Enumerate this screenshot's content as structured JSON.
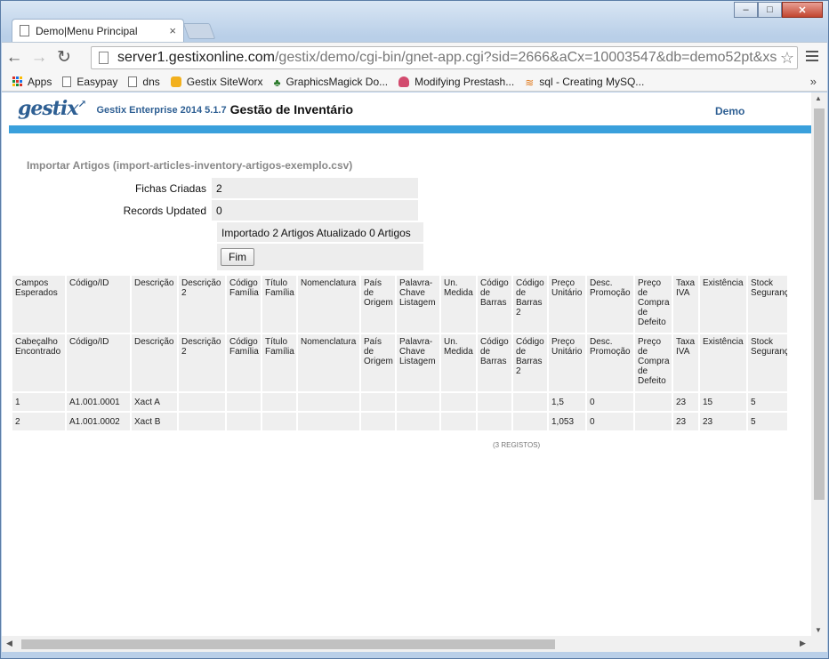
{
  "browser": {
    "tab_title": "Demo|Menu Principal",
    "tab_close": "×",
    "url_host": "server1.gestixonline.com",
    "url_path": "/gestix/demo/cgi-bin/gnet-app.cgi?sid=2666&aCx=10003547&db=demo52pt&xs",
    "bookmarks": [
      "Apps",
      "Easypay",
      "dns",
      "Gestix SiteWorx",
      "GraphicsMagick Do...",
      "Modifying Prestash...",
      "sql - Creating MySQ..."
    ],
    "bookmarks_more": "»"
  },
  "app": {
    "logo": "gestix",
    "version": "Gestix Enterprise 2014 5.1.7",
    "module": "Gestão de Inventário",
    "user": "Demo"
  },
  "import": {
    "title": "Importar Artigos (import-articles-inventory-artigos-exemplo.csv)",
    "created_label": "Fichas Criadas",
    "created_value": "2",
    "updated_label": "Records Updated",
    "updated_value": "0",
    "message": "Importado 2 Artigos Atualizado 0 Artigos",
    "finish_button": "Fim"
  },
  "table": {
    "expected": [
      "Campos Esperados",
      "Código/ID",
      "Descrição",
      "Descrição 2",
      "Código Família",
      "Título Família",
      "Nomenclatura",
      "País de Origem",
      "Palavra-Chave Listagem",
      "Un. Medida",
      "Código de Barras",
      "Código de Barras 2",
      "Preço Unitário",
      "Desc. Promoção",
      "Preço de Compra de Defeito",
      "Taxa IVA",
      "Existência",
      "Stock Seguranç"
    ],
    "found": [
      "Cabeçalho Encontrado",
      "Código/ID",
      "Descrição",
      "Descrição 2",
      "Código Família",
      "Título Família",
      "Nomenclatura",
      "País de Origem",
      "Palavra-Chave Listagem",
      "Un. Medida",
      "Código de Barras",
      "Código de Barras 2",
      "Preço Unitário",
      "Desc. Promoção",
      "Preço de Compra de Defeito",
      "Taxa IVA",
      "Existência",
      "Stock Seguranç"
    ],
    "rows": [
      [
        "1",
        "A1.001.0001",
        "Xact A",
        "",
        "",
        "",
        "",
        "",
        "",
        "",
        "",
        "",
        "1,5",
        "0",
        "",
        "23",
        "15",
        "5"
      ],
      [
        "2",
        "A1.001.0002",
        "Xact B",
        "",
        "",
        "",
        "",
        "",
        "",
        "",
        "",
        "",
        "1,053",
        "0",
        "",
        "23",
        "23",
        "5"
      ]
    ],
    "registos": "(3 REGISTOS)"
  },
  "colors": {
    "accent_bar": "#3aa0dc",
    "brand": "#2e5f93"
  }
}
